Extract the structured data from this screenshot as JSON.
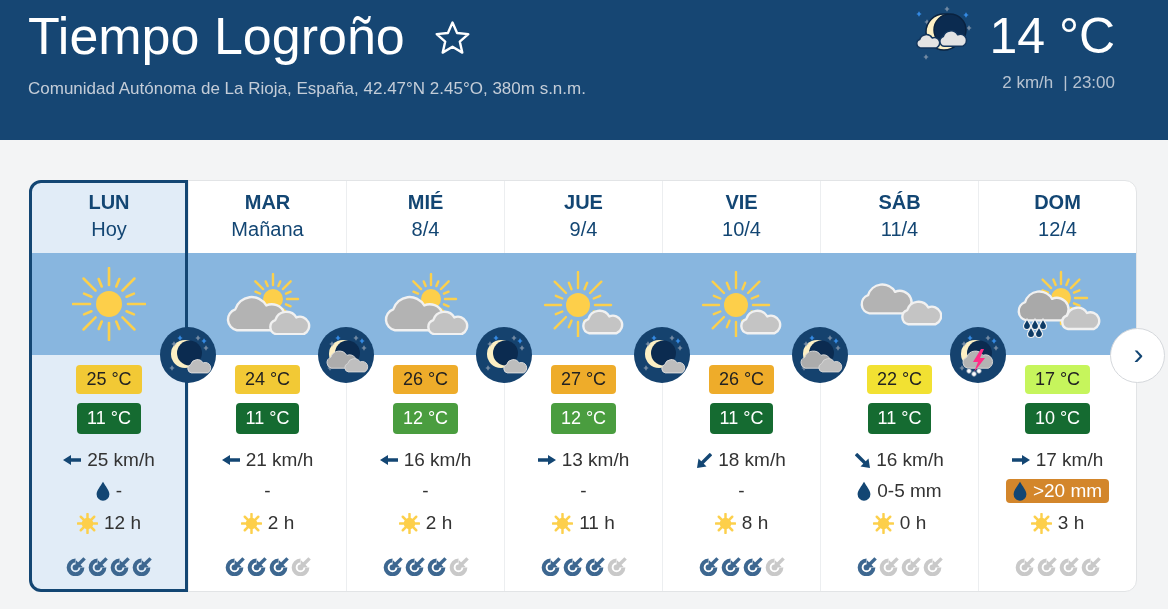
{
  "header": {
    "title": "Tiempo Logroño",
    "favorite": false,
    "subtitle": "Comunidad Autónoma de La Rioja, España, 42.47°N 2.45°O, 380m s.n.m.",
    "current": {
      "temperature": "14 °C",
      "wind": "2 km/h",
      "time": "| 23:00"
    }
  },
  "forecast": {
    "days": [
      {
        "day": "LUN",
        "date": "Hoy",
        "selected": true,
        "weather": {
          "kind": "sunny"
        },
        "night": {
          "kind": "moon-small-cloud"
        },
        "max": {
          "text": "25 °C",
          "color": "#f2c935"
        },
        "min": {
          "text": "11 °C",
          "color": "#156b31"
        },
        "wind": {
          "kind": "left",
          "text": "25 km/h"
        },
        "rain": {
          "kind": "drop",
          "text": "-"
        },
        "sun": "12 h",
        "stars": 4
      },
      {
        "day": "MAR",
        "date": "Mañana",
        "selected": false,
        "weather": {
          "kind": "sun-clouds"
        },
        "night": {
          "kind": "moon-big-clouds"
        },
        "max": {
          "text": "24 °C",
          "color": "#f2c935"
        },
        "min": {
          "text": "11 °C",
          "color": "#156b31"
        },
        "wind": {
          "kind": "left",
          "text": "21 km/h"
        },
        "rain": {
          "kind": "plain",
          "text": "-"
        },
        "sun": "2 h",
        "stars": 3
      },
      {
        "day": "MIÉ",
        "date": "8/4",
        "selected": false,
        "weather": {
          "kind": "sun-clouds"
        },
        "night": {
          "kind": "moon-small-cloud"
        },
        "max": {
          "text": "26 °C",
          "color": "#eeac2a"
        },
        "min": {
          "text": "12 °C",
          "color": "#4a9d3f"
        },
        "wind": {
          "kind": "left",
          "text": "16 km/h"
        },
        "rain": {
          "kind": "plain",
          "text": "-"
        },
        "sun": "2 h",
        "stars": 3
      },
      {
        "day": "JUE",
        "date": "9/4",
        "selected": false,
        "weather": {
          "kind": "sun-small-cloud"
        },
        "night": {
          "kind": "moon-small-cloud"
        },
        "max": {
          "text": "27 °C",
          "color": "#eeac2a"
        },
        "min": {
          "text": "12 °C",
          "color": "#4a9d3f"
        },
        "wind": {
          "kind": "right",
          "text": "13 km/h"
        },
        "rain": {
          "kind": "plain",
          "text": "-"
        },
        "sun": "11 h",
        "stars": 3
      },
      {
        "day": "VIE",
        "date": "10/4",
        "selected": false,
        "weather": {
          "kind": "sun-small-cloud"
        },
        "night": {
          "kind": "moon-big-clouds"
        },
        "max": {
          "text": "26 °C",
          "color": "#eeac2a"
        },
        "min": {
          "text": "11 °C",
          "color": "#156b31"
        },
        "wind": {
          "kind": "down-left",
          "text": "18 km/h"
        },
        "rain": {
          "kind": "plain",
          "text": "-"
        },
        "sun": "8 h",
        "stars": 3
      },
      {
        "day": "SÁB",
        "date": "11/4",
        "selected": false,
        "weather": {
          "kind": "cloudy"
        },
        "night": {
          "kind": "moon-storm"
        },
        "max": {
          "text": "22 °C",
          "color": "#f2e132"
        },
        "min": {
          "text": "11 °C",
          "color": "#156b31"
        },
        "wind": {
          "kind": "down-right",
          "text": "16 km/h"
        },
        "rain": {
          "kind": "drop",
          "text": "0-5 mm"
        },
        "sun": "0 h",
        "stars": 1
      },
      {
        "day": "DOM",
        "date": "12/4",
        "selected": false,
        "weather": {
          "kind": "rain"
        },
        "max": {
          "text": "17 °C",
          "color": "#c6f55c"
        },
        "min": {
          "text": "10 °C",
          "color": "#156b31"
        },
        "wind": {
          "kind": "right",
          "text": "17 km/h"
        },
        "rain": {
          "kind": "alert",
          "text": ">20 mm"
        },
        "sun": "3 h",
        "stars": 0
      }
    ],
    "next_button": "›"
  }
}
